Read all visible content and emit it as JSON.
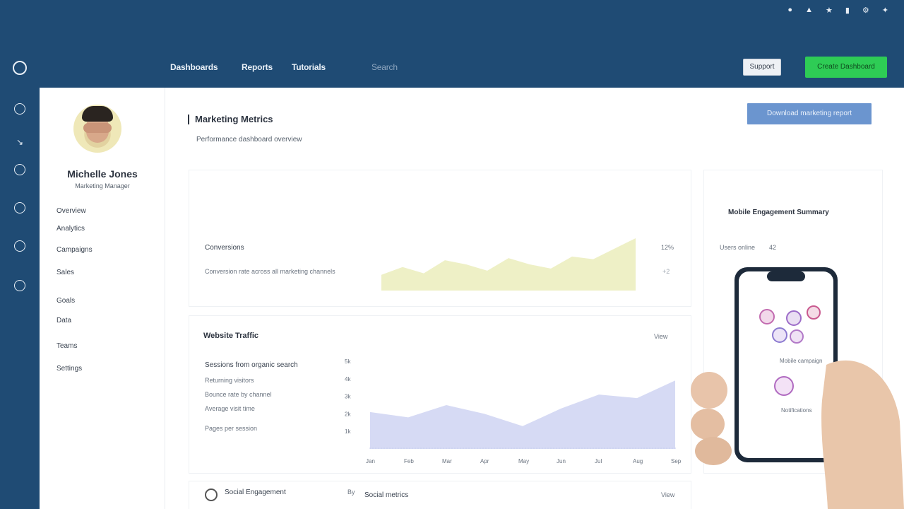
{
  "system_bar": {
    "icons": [
      "wifi-icon",
      "signal-icon",
      "bluetooth-icon",
      "battery-icon",
      "settings-icon",
      "twitter-icon"
    ]
  },
  "rail": {
    "icons": [
      "home-icon",
      "clock-icon",
      "cursor-icon",
      "globe-icon",
      "chat-icon",
      "check-icon",
      "refresh-icon"
    ]
  },
  "navbar": {
    "items": [
      {
        "label": "Dashboards"
      },
      {
        "label": "Reports"
      },
      {
        "label": "Tutorials"
      },
      {
        "label": "Search"
      }
    ],
    "secondary_button": "Support",
    "primary_button": "Create Dashboard"
  },
  "profile": {
    "name": "Michelle Jones",
    "subtitle": "Marketing Manager",
    "menu": [
      {
        "label": "Overview"
      },
      {
        "label": "Analytics"
      },
      {
        "label": "Campaigns"
      },
      {
        "label": "Sales"
      },
      {
        "label": "Goals"
      },
      {
        "label": "Data"
      },
      {
        "label": "Teams"
      },
      {
        "label": "Settings"
      }
    ]
  },
  "content": {
    "title": "Marketing Metrics",
    "subtitle": "Performance dashboard overview",
    "action_button": "Download marketing report",
    "card_a": {
      "label": "Conversions",
      "sublabel": "Conversion rate across all marketing channels",
      "value": "12%",
      "delta": "+2"
    },
    "card_b": {
      "title": "Website Traffic",
      "link": "View",
      "stats": [
        "Sessions from organic search",
        "Returning visitors",
        "Bounce rate by channel",
        "Average visit time",
        "Pages per session"
      ],
      "y_ticks": [
        "5k",
        "4k",
        "3k",
        "2k",
        "1k"
      ],
      "x_ticks": [
        "Jan",
        "Feb",
        "Mar",
        "Apr",
        "May",
        "Jun",
        "Jul",
        "Aug",
        "Sep"
      ]
    },
    "card_c": {
      "title": "Mobile Engagement Summary",
      "label": "Users online",
      "count": "42"
    },
    "card_d": {
      "title": "Social Engagement",
      "col1": "By",
      "col2": "Social metrics",
      "col3": "View"
    },
    "phone": {
      "caption_1": "Mobile campaign",
      "caption_2": "Notifications"
    }
  },
  "chart_data": [
    {
      "type": "area",
      "x": [
        0,
        1,
        2,
        3,
        4,
        5,
        6,
        7,
        8,
        9,
        10,
        11,
        12
      ],
      "values": [
        30,
        45,
        33,
        58,
        50,
        38,
        62,
        50,
        42,
        65,
        60,
        80,
        100
      ],
      "ylim": [
        0,
        100
      ],
      "color": "#eef0c6"
    },
    {
      "type": "area",
      "categories": [
        "Jan",
        "Feb",
        "Mar",
        "Apr",
        "May",
        "Jun",
        "Jul",
        "Aug",
        "Sep"
      ],
      "values": [
        2.1,
        1.8,
        2.5,
        2.0,
        1.3,
        2.3,
        3.1,
        2.9,
        3.9
      ],
      "ylim": [
        0,
        5
      ],
      "color": "#d6daf4"
    }
  ]
}
